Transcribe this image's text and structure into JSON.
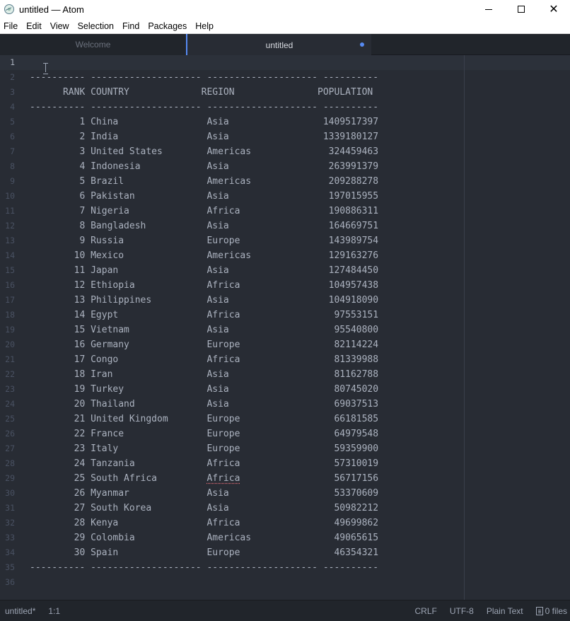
{
  "window": {
    "title": "untitled — Atom",
    "controls": {
      "minimize": "minimize-icon",
      "maximize": "maximize-icon",
      "close": "close-icon"
    }
  },
  "menu": [
    "File",
    "Edit",
    "View",
    "Selection",
    "Find",
    "Packages",
    "Help"
  ],
  "tabs": [
    {
      "label": "Welcome",
      "active": false
    },
    {
      "label": "untitled",
      "active": true,
      "modified": true
    }
  ],
  "editor": {
    "active_line": 1,
    "line_numbers": [
      "1",
      "2",
      "3",
      "4",
      "5",
      "6",
      "7",
      "8",
      "9",
      "10",
      "11",
      "12",
      "13",
      "14",
      "15",
      "16",
      "17",
      "18",
      "19",
      "20",
      "21",
      "22",
      "23",
      "24",
      "25",
      "26",
      "27",
      "28",
      "29",
      "30",
      "31",
      "32",
      "33",
      "34",
      "35",
      "36"
    ],
    "lines": [
      "",
      "---------- -------------------- -------------------- ----------",
      "      RANK COUNTRY             REGION               POPULATION",
      "---------- -------------------- -------------------- ----------",
      "         1 China                Asia                 1409517397",
      "         2 India                Asia                 1339180127",
      "         3 United States        Americas              324459463",
      "         4 Indonesia            Asia                  263991379",
      "         5 Brazil               Americas              209288278",
      "         6 Pakistan             Asia                  197015955",
      "         7 Nigeria              Africa                190886311",
      "         8 Bangladesh           Asia                  164669751",
      "         9 Russia               Europe                143989754",
      "        10 Mexico               Americas              129163276",
      "        11 Japan                Asia                  127484450",
      "        12 Ethiopia             Africa                104957438",
      "        13 Philippines          Asia                  104918090",
      "        14 Egypt                Africa                 97553151",
      "        15 Vietnam              Asia                   95540800",
      "        16 Germany              Europe                 82114224",
      "        17 Congo                Africa                 81339988",
      "        18 Iran                 Asia                   81162788",
      "        19 Turkey               Asia                   80745020",
      "        20 Thailand             Asia                   69037513",
      "        21 United Kingdom       Europe                 66181585",
      "        22 France               Europe                 64979548",
      "        23 Italy                Europe                 59359900",
      "        24 Tanzania             Africa                 57310019",
      "        25 South Africa         Africa                 56717156",
      "        26 Myanmar              Asia                   53370609",
      "        27 South Korea          Asia                   50982212",
      "        28 Kenya                Africa                 49699862",
      "        29 Colombia             Americas               49065615",
      "        30 Spain                Europe                 46354321",
      "---------- -------------------- -------------------- ----------",
      ""
    ]
  },
  "status": {
    "file": "untitled*",
    "cursor": "1:1",
    "line_ending": "CRLF",
    "encoding": "UTF-8",
    "grammar": "Plain Text",
    "files": "0 files"
  },
  "colors": {
    "editor_bg": "#282c34",
    "panel_bg": "#21252b",
    "text": "#abb2bf",
    "accent": "#568af2"
  }
}
